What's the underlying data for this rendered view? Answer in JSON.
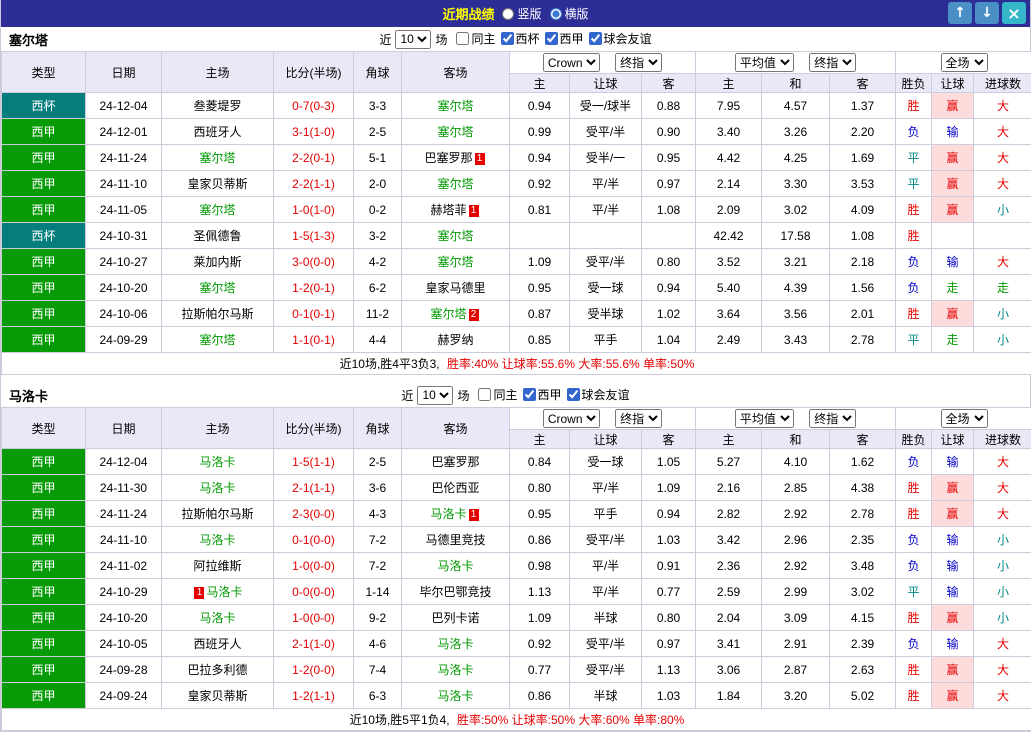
{
  "titlebar": {
    "title": "近期战绩",
    "layout_options": [
      {
        "label": "竖版",
        "selected": false
      },
      {
        "label": "横版",
        "selected": true
      }
    ],
    "up_button": "↑",
    "down_button": "↓",
    "close_button": "×"
  },
  "colors": {
    "titlebar_bg": "#2d2d96",
    "title_text": "#ffff00",
    "liga_badge": "#089b08",
    "cup_badge": "#067d7d",
    "focus_team": "#009900",
    "score_red": "#e60000",
    "lose_blue": "#0000cc",
    "draw_teal": "#008888"
  },
  "sections": [
    {
      "team": "塞尔塔",
      "filters": {
        "near_label": "近",
        "count_value": "10",
        "unit_label": "场",
        "checkboxes": [
          {
            "label": "同主",
            "checked": false
          },
          {
            "label": "西杯",
            "checked": true
          },
          {
            "label": "西甲",
            "checked": true
          },
          {
            "label": "球会友谊",
            "checked": true
          }
        ]
      },
      "selects": {
        "bookmaker": "Crown",
        "asian_type": "终指",
        "euro_avg": "平均值",
        "euro_type": "终指",
        "scope": "全场"
      },
      "headers": [
        "类型",
        "日期",
        "主场",
        "比分(半场)",
        "角球",
        "客场",
        "主",
        "让球",
        "客",
        "主",
        "和",
        "客",
        "胜负",
        "让球",
        "进球数"
      ],
      "rows": [
        {
          "league": "西杯",
          "league_type": "cup",
          "date": "24-12-04",
          "home": {
            "name": "叁菱堤罗",
            "focus": false
          },
          "score": "0-7(0-3)",
          "corner": "3-3",
          "away": {
            "name": "塞尔塔",
            "focus": true
          },
          "odds_home": "0.94",
          "handicap": "受一/球半",
          "odds_away": "0.88",
          "euro_home": "7.95",
          "euro_draw": "4.57",
          "euro_away": "1.37",
          "outcome": "胜",
          "handicap_result": "赢",
          "goals": "大"
        },
        {
          "league": "西甲",
          "league_type": "liga",
          "date": "24-12-01",
          "home": {
            "name": "西班牙人",
            "focus": false
          },
          "score": "3-1(1-0)",
          "corner": "2-5",
          "away": {
            "name": "塞尔塔",
            "focus": true
          },
          "odds_home": "0.99",
          "handicap": "受平/半",
          "odds_away": "0.90",
          "euro_home": "3.40",
          "euro_draw": "3.26",
          "euro_away": "2.20",
          "outcome": "负",
          "handicap_result": "输",
          "goals": "大"
        },
        {
          "league": "西甲",
          "league_type": "liga",
          "date": "24-11-24",
          "home": {
            "name": "塞尔塔",
            "focus": true
          },
          "score": "2-2(0-1)",
          "corner": "5-1",
          "away": {
            "name": "巴塞罗那",
            "focus": false,
            "card": {
              "count": "1",
              "pos": "after"
            }
          },
          "odds_home": "0.94",
          "handicap": "受半/一",
          "odds_away": "0.95",
          "euro_home": "4.42",
          "euro_draw": "4.25",
          "euro_away": "1.69",
          "outcome": "平",
          "handicap_result": "赢",
          "goals": "大"
        },
        {
          "league": "西甲",
          "league_type": "liga",
          "date": "24-11-10",
          "home": {
            "name": "皇家贝蒂斯",
            "focus": false
          },
          "score": "2-2(1-1)",
          "corner": "2-0",
          "away": {
            "name": "塞尔塔",
            "focus": true
          },
          "odds_home": "0.92",
          "handicap": "平/半",
          "odds_away": "0.97",
          "euro_home": "2.14",
          "euro_draw": "3.30",
          "euro_away": "3.53",
          "outcome": "平",
          "handicap_result": "赢",
          "goals": "大"
        },
        {
          "league": "西甲",
          "league_type": "liga",
          "date": "24-11-05",
          "home": {
            "name": "塞尔塔",
            "focus": true
          },
          "score": "1-0(1-0)",
          "corner": "0-2",
          "away": {
            "name": "赫塔菲",
            "focus": false,
            "card": {
              "count": "1",
              "pos": "after"
            }
          },
          "odds_home": "0.81",
          "handicap": "平/半",
          "odds_away": "1.08",
          "euro_home": "2.09",
          "euro_draw": "3.02",
          "euro_away": "4.09",
          "outcome": "胜",
          "handicap_result": "赢",
          "goals": "小"
        },
        {
          "league": "西杯",
          "league_type": "cup",
          "date": "24-10-31",
          "home": {
            "name": "圣佩德鲁",
            "focus": false
          },
          "score": "1-5(1-3)",
          "corner": "3-2",
          "away": {
            "name": "塞尔塔",
            "focus": true
          },
          "odds_home": "",
          "handicap": "",
          "odds_away": "",
          "euro_home": "42.42",
          "euro_draw": "17.58",
          "euro_away": "1.08",
          "outcome": "胜",
          "handicap_result": "",
          "goals": ""
        },
        {
          "league": "西甲",
          "league_type": "liga",
          "date": "24-10-27",
          "home": {
            "name": "莱加内斯",
            "focus": false
          },
          "score": "3-0(0-0)",
          "corner": "4-2",
          "away": {
            "name": "塞尔塔",
            "focus": true
          },
          "odds_home": "1.09",
          "handicap": "受平/半",
          "odds_away": "0.80",
          "euro_home": "3.52",
          "euro_draw": "3.21",
          "euro_away": "2.18",
          "outcome": "负",
          "handicap_result": "输",
          "goals": "大"
        },
        {
          "league": "西甲",
          "league_type": "liga",
          "date": "24-10-20",
          "home": {
            "name": "塞尔塔",
            "focus": true
          },
          "score": "1-2(0-1)",
          "corner": "6-2",
          "away": {
            "name": "皇家马德里",
            "focus": false
          },
          "odds_home": "0.95",
          "handicap": "受一球",
          "odds_away": "0.94",
          "euro_home": "5.40",
          "euro_draw": "4.39",
          "euro_away": "1.56",
          "outcome": "负",
          "handicap_result": "走",
          "goals": "走"
        },
        {
          "league": "西甲",
          "league_type": "liga",
          "date": "24-10-06",
          "home": {
            "name": "拉斯帕尔马斯",
            "focus": false
          },
          "score": "0-1(0-1)",
          "corner": "11-2",
          "away": {
            "name": "塞尔塔",
            "focus": true,
            "card": {
              "count": "2",
              "pos": "after"
            }
          },
          "odds_home": "0.87",
          "handicap": "受半球",
          "odds_away": "1.02",
          "euro_home": "3.64",
          "euro_draw": "3.56",
          "euro_away": "2.01",
          "outcome": "胜",
          "handicap_result": "赢",
          "goals": "小"
        },
        {
          "league": "西甲",
          "league_type": "liga",
          "date": "24-09-29",
          "home": {
            "name": "塞尔塔",
            "focus": true
          },
          "score": "1-1(0-1)",
          "corner": "4-4",
          "away": {
            "name": "赫罗纳",
            "focus": false
          },
          "odds_home": "0.85",
          "handicap": "平手",
          "odds_away": "1.04",
          "euro_home": "2.49",
          "euro_draw": "3.43",
          "euro_away": "2.78",
          "outcome": "平",
          "handicap_result": "走",
          "goals": "小"
        }
      ],
      "summary_prefix": "近10场,胜4平3负3,",
      "summary_stats": "胜率:40% 让球率:55.6% 大率:55.6% 单率:50%"
    },
    {
      "team": "马洛卡",
      "filters": {
        "near_label": "近",
        "count_value": "10",
        "unit_label": "场",
        "checkboxes": [
          {
            "label": "同主",
            "checked": false
          },
          {
            "label": "西甲",
            "checked": true
          },
          {
            "label": "球会友谊",
            "checked": true
          }
        ]
      },
      "selects": {
        "bookmaker": "Crown",
        "asian_type": "终指",
        "euro_avg": "平均值",
        "euro_type": "终指",
        "scope": "全场"
      },
      "headers": [
        "类型",
        "日期",
        "主场",
        "比分(半场)",
        "角球",
        "客场",
        "主",
        "让球",
        "客",
        "主",
        "和",
        "客",
        "胜负",
        "让球",
        "进球数"
      ],
      "rows": [
        {
          "league": "西甲",
          "league_type": "liga",
          "date": "24-12-04",
          "home": {
            "name": "马洛卡",
            "focus": true
          },
          "score": "1-5(1-1)",
          "corner": "2-5",
          "away": {
            "name": "巴塞罗那",
            "focus": false
          },
          "odds_home": "0.84",
          "handicap": "受一球",
          "odds_away": "1.05",
          "euro_home": "5.27",
          "euro_draw": "4.10",
          "euro_away": "1.62",
          "outcome": "负",
          "handicap_result": "输",
          "goals": "大"
        },
        {
          "league": "西甲",
          "league_type": "liga",
          "date": "24-11-30",
          "home": {
            "name": "马洛卡",
            "focus": true
          },
          "score": "2-1(1-1)",
          "corner": "3-6",
          "away": {
            "name": "巴伦西亚",
            "focus": false
          },
          "odds_home": "0.80",
          "handicap": "平/半",
          "odds_away": "1.09",
          "euro_home": "2.16",
          "euro_draw": "2.85",
          "euro_away": "4.38",
          "outcome": "胜",
          "handicap_result": "赢",
          "goals": "大"
        },
        {
          "league": "西甲",
          "league_type": "liga",
          "date": "24-11-24",
          "home": {
            "name": "拉斯帕尔马斯",
            "focus": false
          },
          "score": "2-3(0-0)",
          "corner": "4-3",
          "away": {
            "name": "马洛卡",
            "focus": true,
            "card": {
              "count": "1",
              "pos": "after"
            }
          },
          "odds_home": "0.95",
          "handicap": "平手",
          "odds_away": "0.94",
          "euro_home": "2.82",
          "euro_draw": "2.92",
          "euro_away": "2.78",
          "outcome": "胜",
          "handicap_result": "赢",
          "goals": "大"
        },
        {
          "league": "西甲",
          "league_type": "liga",
          "date": "24-11-10",
          "home": {
            "name": "马洛卡",
            "focus": true
          },
          "score": "0-1(0-0)",
          "corner": "7-2",
          "away": {
            "name": "马德里竞技",
            "focus": false
          },
          "odds_home": "0.86",
          "handicap": "受平/半",
          "odds_away": "1.03",
          "euro_home": "3.42",
          "euro_draw": "2.96",
          "euro_away": "2.35",
          "outcome": "负",
          "handicap_result": "输",
          "goals": "小"
        },
        {
          "league": "西甲",
          "league_type": "liga",
          "date": "24-11-02",
          "home": {
            "name": "阿拉维斯",
            "focus": false
          },
          "score": "1-0(0-0)",
          "corner": "7-2",
          "away": {
            "name": "马洛卡",
            "focus": true
          },
          "odds_home": "0.98",
          "handicap": "平/半",
          "odds_away": "0.91",
          "euro_home": "2.36",
          "euro_draw": "2.92",
          "euro_away": "3.48",
          "outcome": "负",
          "handicap_result": "输",
          "goals": "小"
        },
        {
          "league": "西甲",
          "league_type": "liga",
          "date": "24-10-29",
          "home": {
            "name": "马洛卡",
            "focus": true,
            "card": {
              "count": "1",
              "pos": "before"
            }
          },
          "score": "0-0(0-0)",
          "corner": "1-14",
          "away": {
            "name": "毕尔巴鄂竞技",
            "focus": false
          },
          "odds_home": "1.13",
          "handicap": "平/半",
          "odds_away": "0.77",
          "euro_home": "2.59",
          "euro_draw": "2.99",
          "euro_away": "3.02",
          "outcome": "平",
          "handicap_result": "输",
          "goals": "小"
        },
        {
          "league": "西甲",
          "league_type": "liga",
          "date": "24-10-20",
          "home": {
            "name": "马洛卡",
            "focus": true
          },
          "score": "1-0(0-0)",
          "corner": "9-2",
          "away": {
            "name": "巴列卡诺",
            "focus": false
          },
          "odds_home": "1.09",
          "handicap": "半球",
          "odds_away": "0.80",
          "euro_home": "2.04",
          "euro_draw": "3.09",
          "euro_away": "4.15",
          "outcome": "胜",
          "handicap_result": "赢",
          "goals": "小"
        },
        {
          "league": "西甲",
          "league_type": "liga",
          "date": "24-10-05",
          "home": {
            "name": "西班牙人",
            "focus": false
          },
          "score": "2-1(1-0)",
          "corner": "4-6",
          "away": {
            "name": "马洛卡",
            "focus": true
          },
          "odds_home": "0.92",
          "handicap": "受平/半",
          "odds_away": "0.97",
          "euro_home": "3.41",
          "euro_draw": "2.91",
          "euro_away": "2.39",
          "outcome": "负",
          "handicap_result": "输",
          "goals": "大"
        },
        {
          "league": "西甲",
          "league_type": "liga",
          "date": "24-09-28",
          "home": {
            "name": "巴拉多利德",
            "focus": false
          },
          "score": "1-2(0-0)",
          "corner": "7-4",
          "away": {
            "name": "马洛卡",
            "focus": true
          },
          "odds_home": "0.77",
          "handicap": "受平/半",
          "odds_away": "1.13",
          "euro_home": "3.06",
          "euro_draw": "2.87",
          "euro_away": "2.63",
          "outcome": "胜",
          "handicap_result": "赢",
          "goals": "大"
        },
        {
          "league": "西甲",
          "league_type": "liga",
          "date": "24-09-24",
          "home": {
            "name": "皇家贝蒂斯",
            "focus": false
          },
          "score": "1-2(1-1)",
          "corner": "6-3",
          "away": {
            "name": "马洛卡",
            "focus": true
          },
          "odds_home": "0.86",
          "handicap": "半球",
          "odds_away": "1.03",
          "euro_home": "1.84",
          "euro_draw": "3.20",
          "euro_away": "5.02",
          "outcome": "胜",
          "handicap_result": "赢",
          "goals": "大"
        }
      ],
      "summary_prefix": "近10场,胜5平1负4,",
      "summary_stats": "胜率:50% 让球率:50% 大率:60% 单率:80%"
    }
  ]
}
